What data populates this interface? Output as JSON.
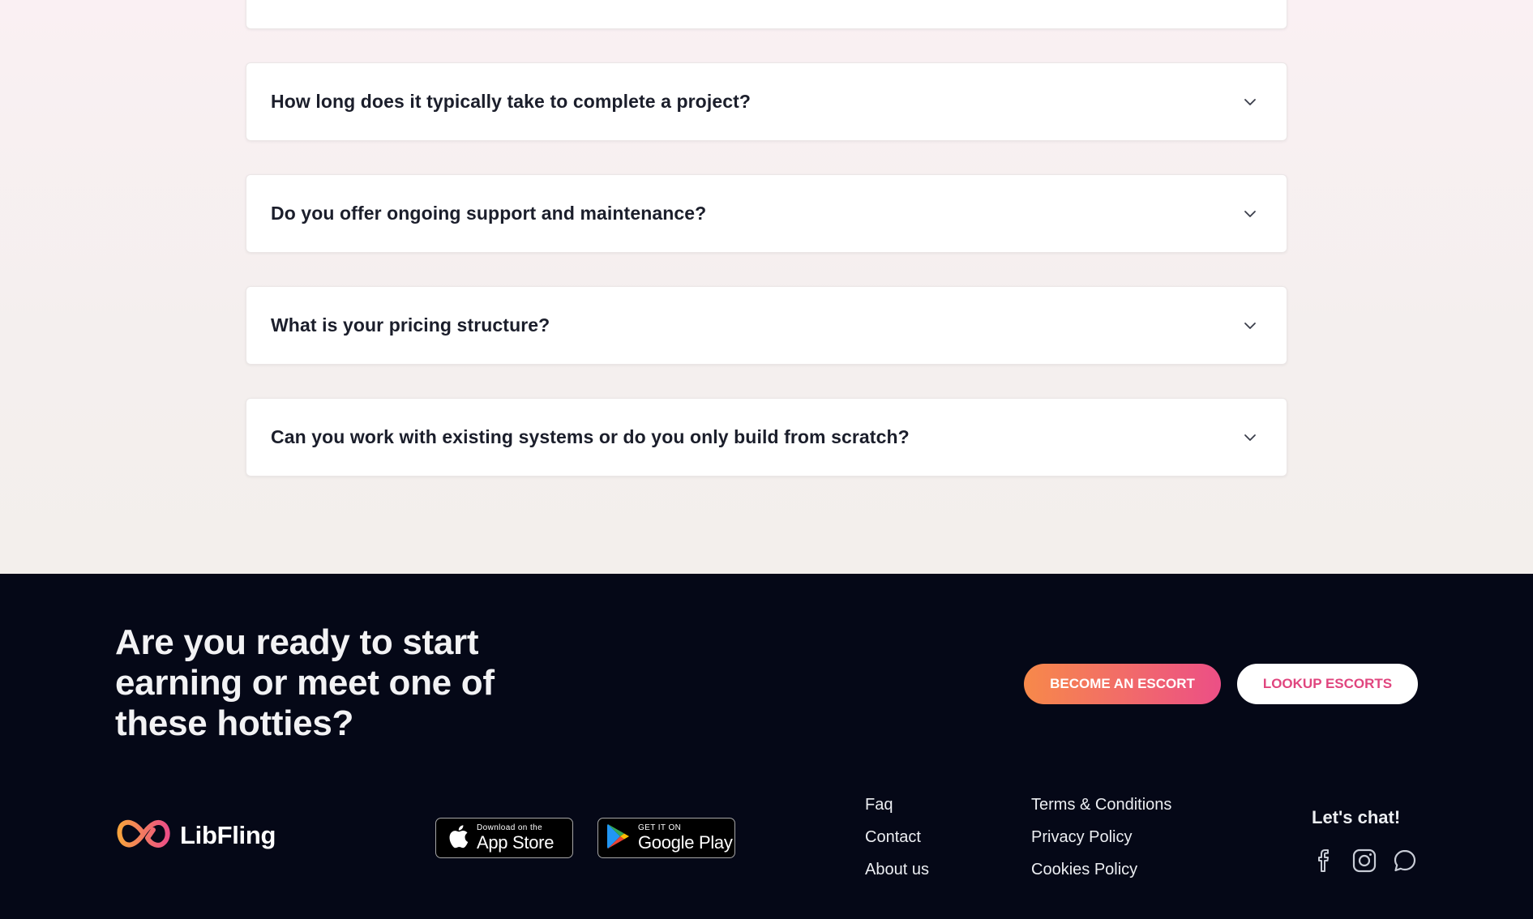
{
  "faq": {
    "items": [
      {
        "question": ""
      },
      {
        "question": "How long does it typically take to complete a project?"
      },
      {
        "question": "Do you offer ongoing support and maintenance?"
      },
      {
        "question": "What is your pricing structure?"
      },
      {
        "question": "Can you work with existing systems or do you only build from scratch?"
      }
    ],
    "chevron_icon": "chevron-down-icon"
  },
  "footer": {
    "cta_title": "Are you ready to start earning or meet one of these hotties?",
    "become_button": "BECOME AN ESCORT",
    "lookup_button": "LOOKUP ESCORTS",
    "brand": {
      "name": "LibFling",
      "icon": "infinity-heart-logo"
    },
    "app_store": {
      "small": "Download on the",
      "big": "App Store",
      "icon": "apple-icon"
    },
    "google_play": {
      "small": "GET IT ON",
      "big": "Google Play",
      "icon": "play-icon"
    },
    "links_col1": [
      "Faq",
      "Contact",
      "About us"
    ],
    "links_col2": [
      "Terms & Conditions",
      "Privacy Policy",
      "Cookies Policy"
    ],
    "chat_title": "Let's chat!",
    "social_icons": [
      "facebook-icon",
      "instagram-icon",
      "chat-bubble-icon"
    ],
    "colors": {
      "background": "#050817",
      "accent_start": "#f7894a",
      "accent_end": "#ec4f86",
      "lookup_text": "#e0457e"
    }
  }
}
